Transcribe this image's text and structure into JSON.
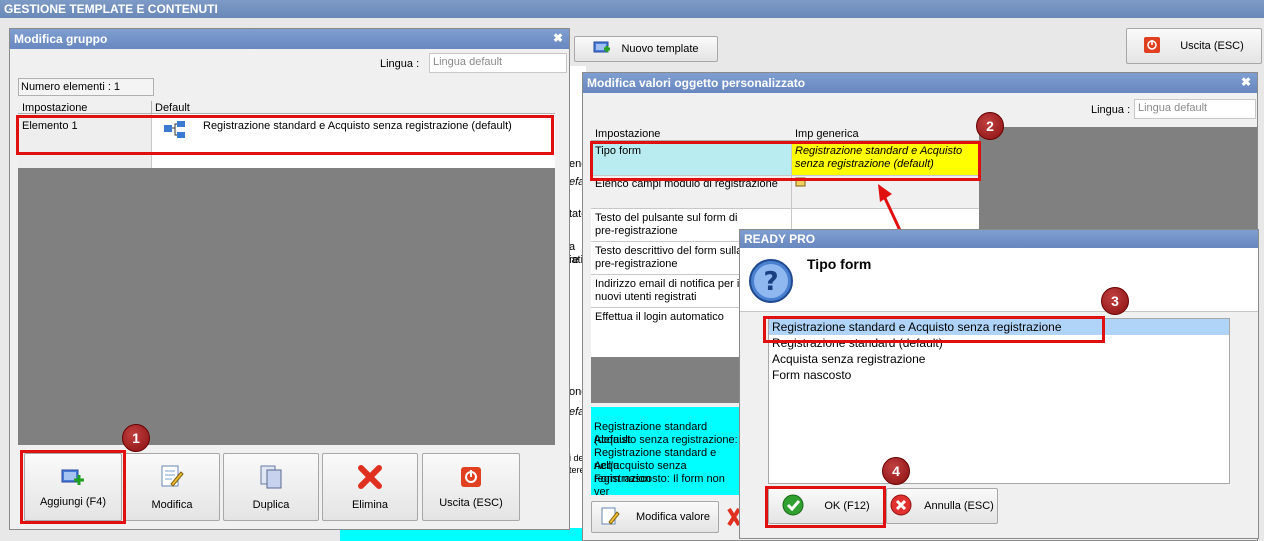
{
  "app": {
    "title": "GESTIONE TEMPLATE E CONTENUTI"
  },
  "toolbar": {
    "new_template_label": "Nuovo template",
    "exit_label": "Uscita (ESC)"
  },
  "group_window": {
    "title": "Modifica gruppo",
    "lingua_label": "Lingua :",
    "lingua_placeholder": "Lingua default",
    "count_label": "Numero elementi : 1",
    "headers": [
      "Impostazione",
      "Default"
    ],
    "row": {
      "name": "Elemento 1",
      "value": "Registrazione standard e Acquisto senza registrazione (default)"
    },
    "buttons": {
      "add": "Aggiungi (F4)",
      "edit": "Modifica",
      "duplicate": "Duplica",
      "delete": "Elimina",
      "exit": "Uscita (ESC)"
    }
  },
  "object_window": {
    "title": "Modifica valori oggetto personalizzato",
    "lingua_label": "Lingua :",
    "lingua_placeholder": "Lingua default",
    "headers": [
      "Impostazione",
      "Imp generica"
    ],
    "rows": [
      {
        "name": "Tipo form",
        "value": "Registrazione standard e Acquisto senza registrazione (default)"
      },
      {
        "name": "Elenco campi modulo di registrazione",
        "value": ""
      },
      {
        "name": "Testo del pulsante sul form di pre-registrazione",
        "value": ""
      },
      {
        "name": "Testo descrittivo del form sulla pre-registrazione",
        "value": ""
      },
      {
        "name": "Indirizzo email di notifica per i nuovi utenti registrati",
        "value": ""
      },
      {
        "name": "Effettua il login automatico",
        "value": ""
      }
    ],
    "description_lines": [
      "Registrazione standard (default",
      "Acquisto senza registrazione: I",
      "Registrazione standard e Acqu",
      "nell'acquisto senza registrazion",
      "Form nascosto: Il form non ver"
    ],
    "edit_value_label": "Modifica valore"
  },
  "dialog": {
    "title": "READY PRO",
    "heading": "Tipo form",
    "options": [
      "Registrazione standard e Acquisto senza registrazione",
      "Registrazione standard (default)",
      "Acquista senza registrazione",
      "Form nascosto"
    ],
    "selected_index": 0,
    "ok_label": "OK (F12)",
    "cancel_label": "Annulla (ESC)"
  },
  "background_fragments": [
    "ene",
    "efa",
    "tato",
    "a re",
    "iati",
    "ong",
    "efa",
    "i de",
    "tere"
  ],
  "steps": [
    "1",
    "2",
    "3",
    "4"
  ],
  "colors": {
    "title_bar": "#6a89c0",
    "highlight": "#e01010",
    "badge": "#8b1010",
    "selected_row": "#b8ecf0",
    "yellow_cell": "#ffff00",
    "cyan_panel": "#00ffff"
  },
  "icons": [
    "exit-icon",
    "new-template-icon",
    "add-icon",
    "edit-icon",
    "duplicate-icon",
    "delete-icon",
    "tree-icon",
    "question-icon",
    "ok-check-icon",
    "cancel-x-icon"
  ]
}
